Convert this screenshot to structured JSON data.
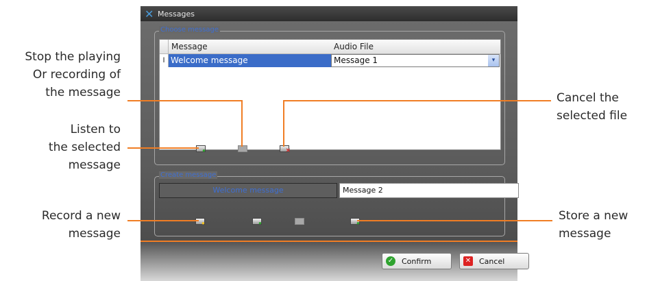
{
  "window": {
    "title": "Messages",
    "icon": "x-logo-icon"
  },
  "choose_group": {
    "label": "Choose message",
    "columns": [
      "Message",
      "Audio File"
    ],
    "rows": [
      {
        "indicator": "I",
        "message": "Welcome message",
        "audio_file": "Message 1"
      }
    ],
    "dropdown_arrow": "▾",
    "buttons": [
      "play-icon",
      "stop-icon",
      "cancel-file-icon"
    ]
  },
  "create_group": {
    "label": "Create message",
    "name_display": "Welcome message",
    "name_input_value": "Message 2",
    "buttons": [
      "record-icon",
      "play-icon",
      "stop-icon",
      "store-icon"
    ]
  },
  "footer": {
    "confirm_label": "Confirm",
    "cancel_label": "Cancel"
  },
  "callouts": {
    "stop": [
      "Stop the playing",
      "Or recording of",
      "the message"
    ],
    "listen": [
      "Listen to",
      "the selected",
      "message"
    ],
    "cancel_file": [
      "Cancel the",
      "selected file"
    ],
    "record": [
      "Record a new",
      "message"
    ],
    "store": [
      "Store a new",
      "message"
    ]
  },
  "colors": {
    "accent_orange": "#f07d24",
    "selection_blue": "#3a6cc8",
    "label_blue": "#3f6fd2"
  }
}
